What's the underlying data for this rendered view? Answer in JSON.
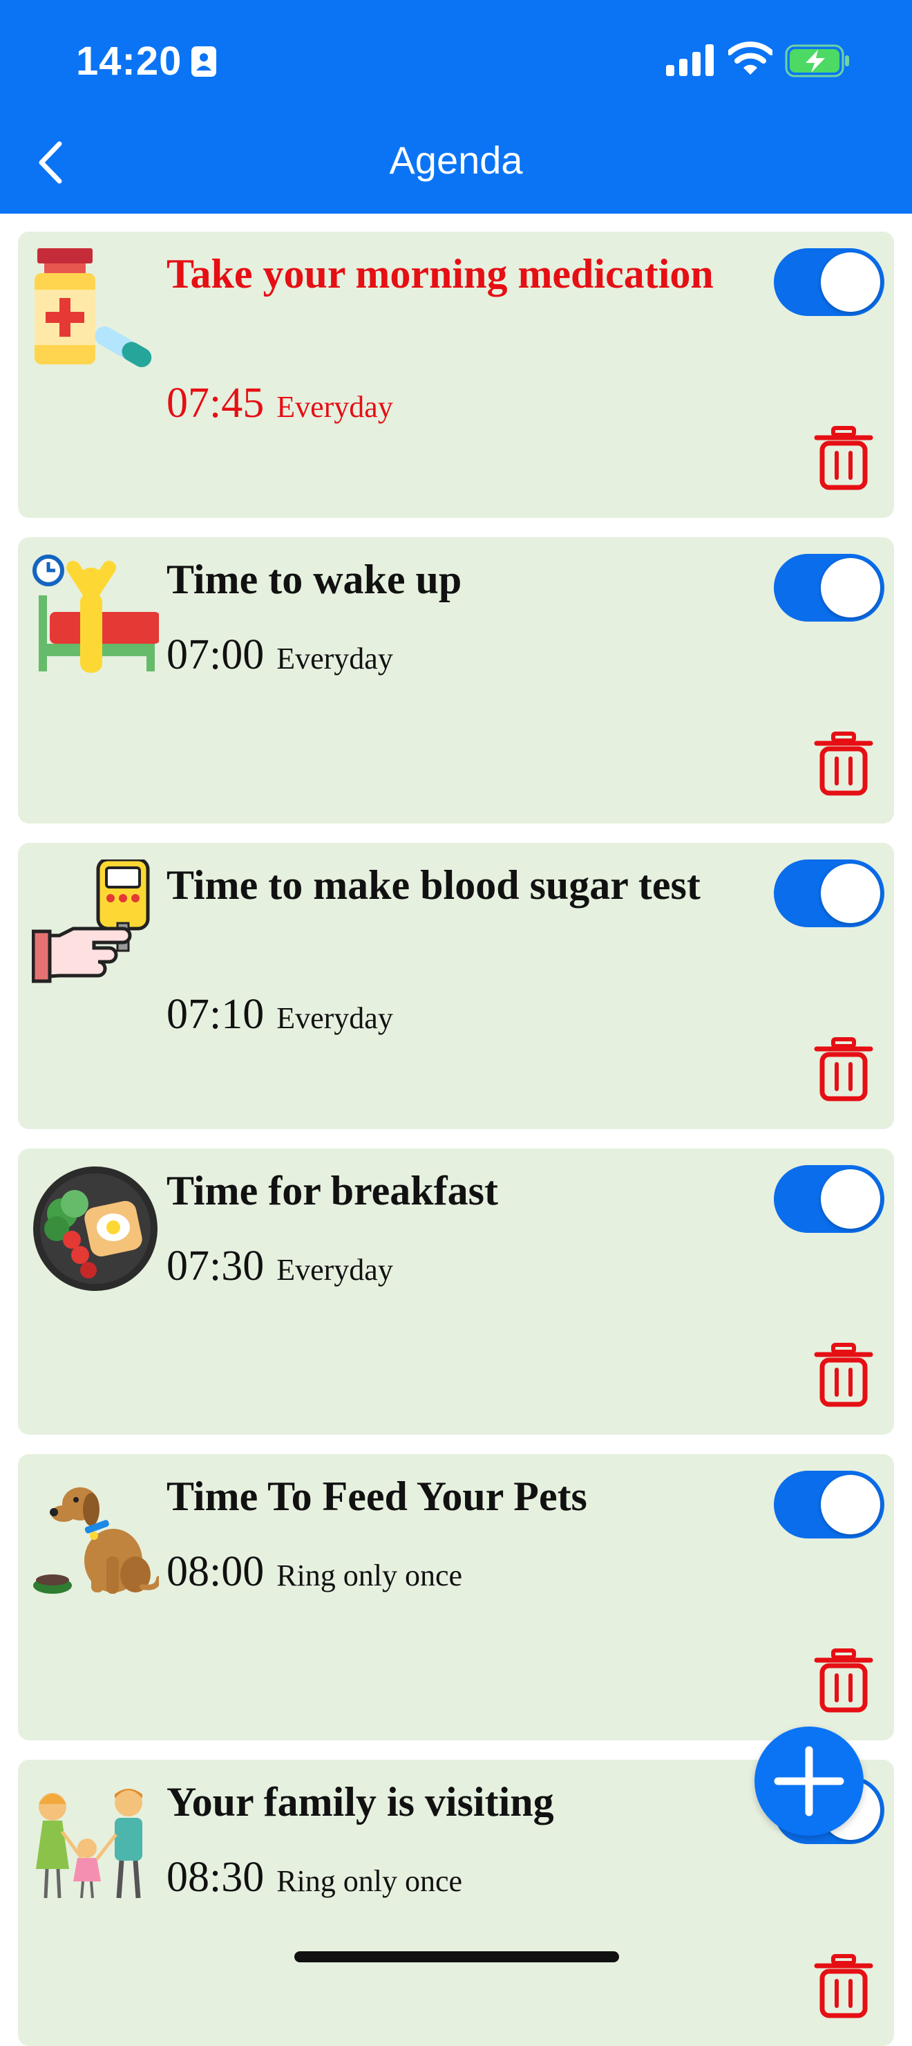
{
  "status_bar": {
    "time": "14:20",
    "icons": [
      "id-badge-icon",
      "signal-icon",
      "wifi-icon",
      "battery-charging-icon"
    ]
  },
  "header": {
    "title": "Agenda",
    "back_icon": "chevron-left-icon"
  },
  "reminders": [
    {
      "image": "medication-icon",
      "title": "Take your morning medication",
      "time": "07:45",
      "repeat": "Everyday",
      "highlighted": true,
      "enabled": true,
      "text_color": "#E50F14"
    },
    {
      "image": "wake-up-icon",
      "title": "Time to wake up",
      "time": "07:00",
      "repeat": "Everyday",
      "highlighted": false,
      "enabled": true
    },
    {
      "image": "glucose-meter-icon",
      "title": "Time to make blood sugar test",
      "time": "07:10",
      "repeat": "Everyday",
      "highlighted": false,
      "enabled": true
    },
    {
      "image": "breakfast-icon",
      "title": "Time for breakfast",
      "time": "07:30",
      "repeat": "Everyday",
      "highlighted": false,
      "enabled": true
    },
    {
      "image": "pet-dog-icon",
      "title": "Time To Feed Your Pets",
      "time": "08:00",
      "repeat": "Ring only once",
      "highlighted": false,
      "enabled": true
    },
    {
      "image": "family-icon",
      "title": "Your family is visiting",
      "time": "08:30",
      "repeat": "Ring only once",
      "highlighted": false,
      "enabled": true
    }
  ],
  "actions": {
    "add_icon": "plus-icon",
    "delete_icon": "trash-icon"
  },
  "colors": {
    "accent": "#0A74F5",
    "card_background": "#E6F0DF",
    "delete": "#E50F14",
    "toggle_on": "#0A6DEB"
  }
}
